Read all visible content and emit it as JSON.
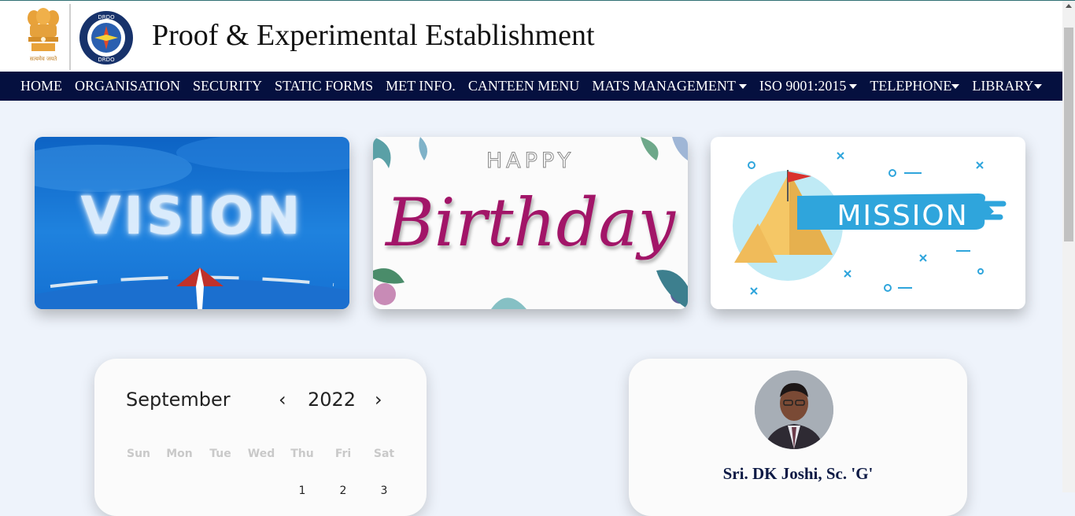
{
  "header": {
    "title": "Proof & Experimental Establishment",
    "emblem_motto": "सत्यमेव जयते",
    "drdo_logo_text": "DRDO"
  },
  "nav": {
    "items": [
      {
        "label": "HOME",
        "dropdown": false
      },
      {
        "label": "ORGANISATION",
        "dropdown": false
      },
      {
        "label": "SECURITY",
        "dropdown": false
      },
      {
        "label": "STATIC FORMS",
        "dropdown": false
      },
      {
        "label": "MET INFO.",
        "dropdown": false
      },
      {
        "label": "CANTEEN MENU",
        "dropdown": false
      },
      {
        "label": "MATS MANAGEMENT",
        "dropdown": true
      },
      {
        "label": "ISO 9001:2015",
        "dropdown": true
      },
      {
        "label": "TELEPHONE",
        "dropdown": true
      },
      {
        "label": "LIBRARY",
        "dropdown": true
      }
    ]
  },
  "cards": {
    "vision": {
      "text": "VISION"
    },
    "birthday": {
      "happy": "HAPPY",
      "text": "Birthday"
    },
    "mission": {
      "text": "MISSION"
    }
  },
  "calendar": {
    "month": "September",
    "year": "2022",
    "prev": "‹",
    "next": "›",
    "weekdays": [
      "Sun",
      "Mon",
      "Tue",
      "Wed",
      "Thu",
      "Fri",
      "Sat"
    ],
    "first_row": [
      "",
      "",
      "",
      "",
      "1",
      "2",
      "3"
    ]
  },
  "director": {
    "name": "Sri. DK Joshi, Sc. 'G'"
  },
  "colors": {
    "nav_bg": "#05103f",
    "page_bg": "#eef3fb",
    "birthday_text": "#a21568",
    "name_text": "#0d1a45"
  }
}
